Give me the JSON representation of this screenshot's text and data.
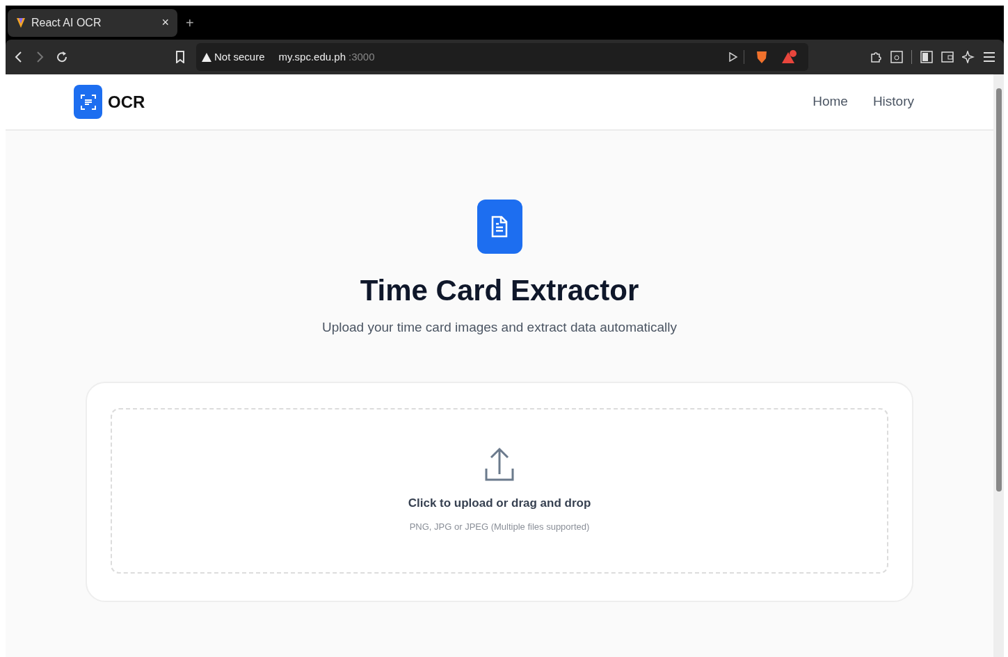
{
  "browser": {
    "tab": {
      "title": "React AI OCR",
      "close": "×"
    },
    "new_tab": "+",
    "security": "Not secure",
    "url_host": "my.spc.edu.ph",
    "url_port": ":3000"
  },
  "navbar": {
    "brand": "OCR",
    "links": [
      "Home",
      "History"
    ]
  },
  "hero": {
    "title": "Time Card Extractor",
    "subtitle": "Upload your time card images and extract data automatically"
  },
  "upload": {
    "prompt": "Click to upload or drag and drop",
    "hint": "PNG, JPG or JPEG (Multiple files supported)"
  }
}
